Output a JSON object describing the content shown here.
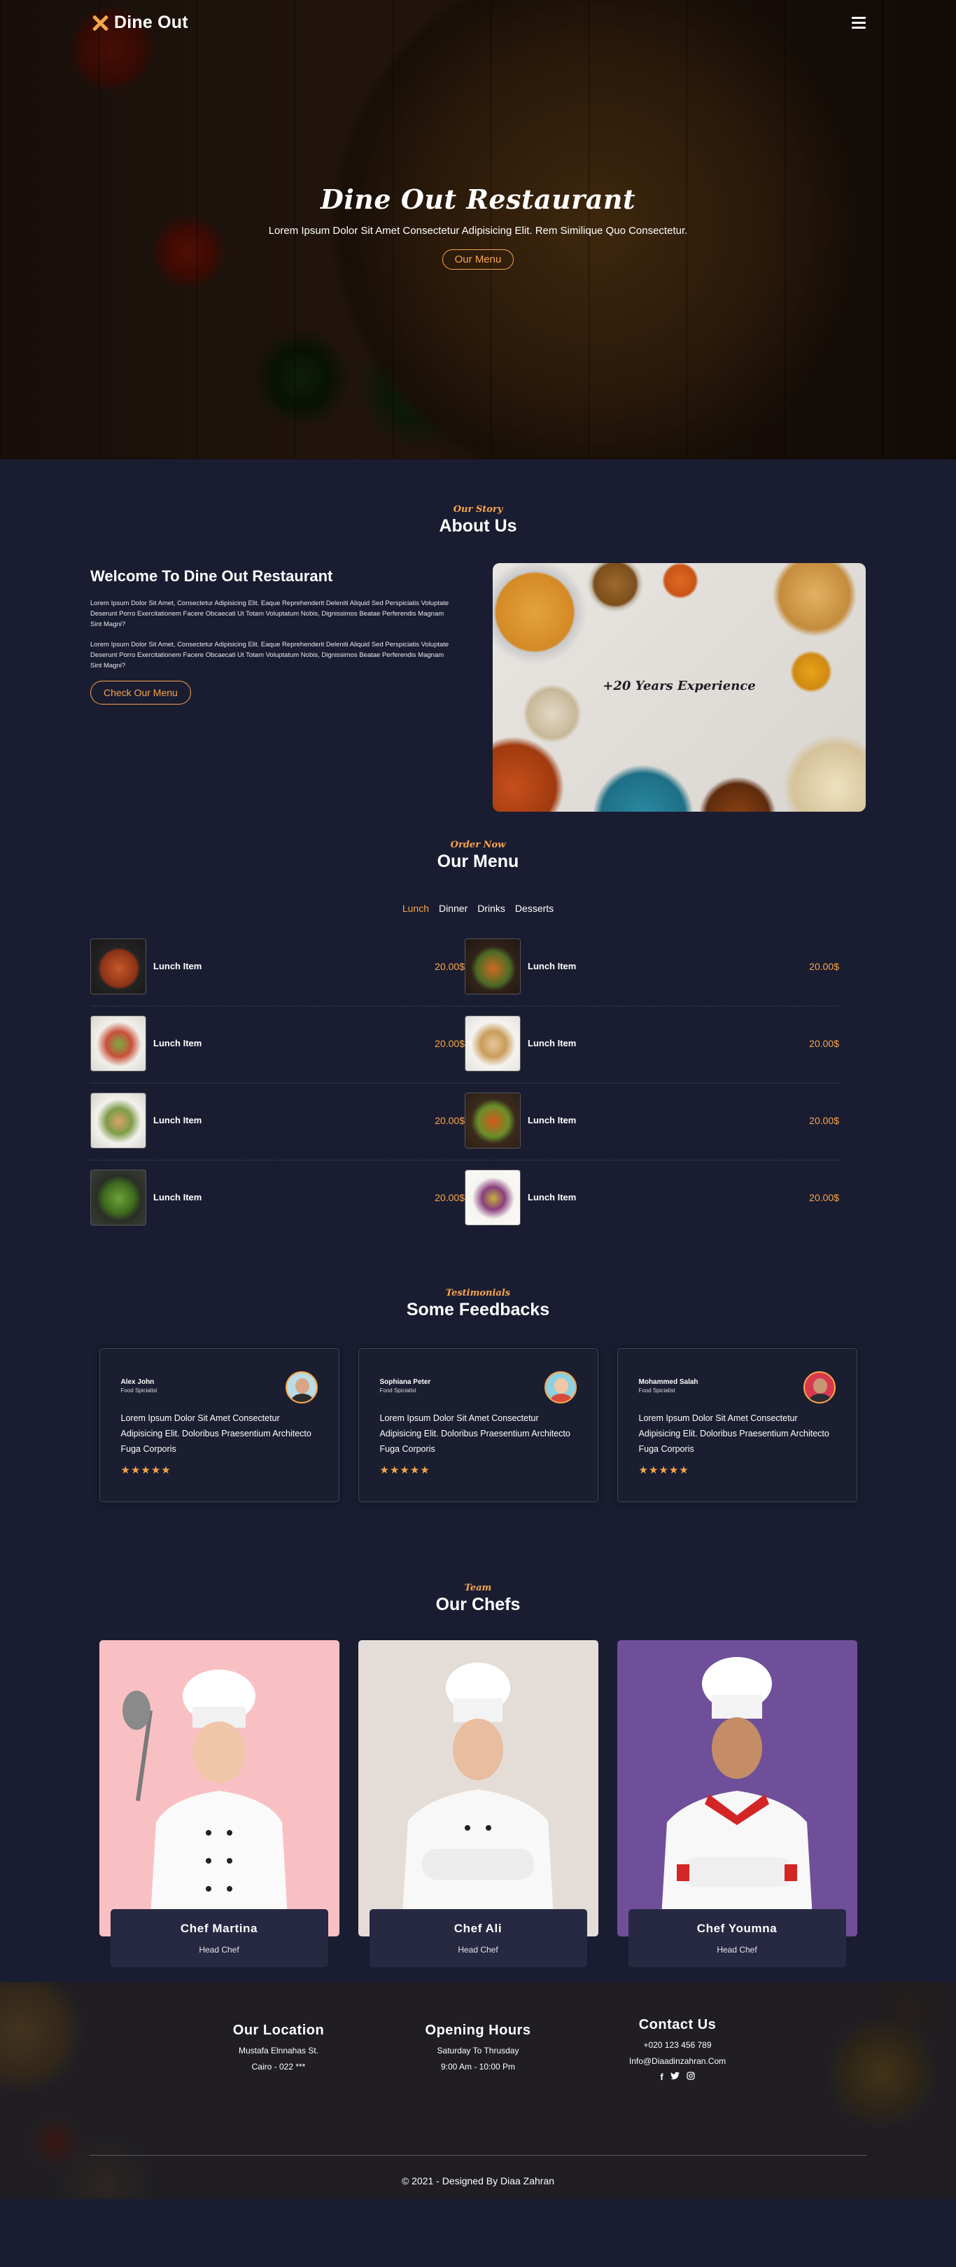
{
  "nav": {
    "brand": "Dine Out"
  },
  "hero": {
    "title": "Dine Out Restaurant",
    "subtitle": "Lorem Ipsum Dolor Sit Amet Consectetur Adipisicing Elit. Rem Similique Quo Consectetur.",
    "button": "Our Menu"
  },
  "about": {
    "kicker": "Our Story",
    "title": "About Us",
    "heading": "Welcome To Dine Out Restaurant",
    "para1": "Lorem Ipsum Dolor Sit Amet, Consectetur Adipisicing Elit. Eaque Reprehenderit Deleniti Aliquid Sed Perspiciatis Voluptate Deserunt Porro Exercitationem Facere Obcaecati Ut Totam Voluptatum Nobis, Dignissimos Beatae Perferendis Magnam Sint Magni?",
    "para2": "Lorem Ipsum Dolor Sit Amet, Consectetur Adipisicing Elit. Eaque Reprehenderit Deleniti Aliquid Sed Perspiciatis Voluptate Deserunt Porro Exercitationem Facere Obcaecati Ut Totam Voluptatum Nobis, Dignissimos Beatae Perferendis Magnam Sint Magni?",
    "button": "Check Our Menu",
    "image_caption": "+20 Years Experience"
  },
  "menu": {
    "kicker": "Order Now",
    "title": "Our Menu",
    "tabs": [
      "Lunch",
      "Dinner",
      "Drinks",
      "Desserts"
    ],
    "active_tab": "Lunch",
    "items": [
      {
        "name": "Lunch Item",
        "price": "20.00$"
      },
      {
        "name": "Lunch Item",
        "price": "20.00$"
      },
      {
        "name": "Lunch Item",
        "price": "20.00$"
      },
      {
        "name": "Lunch Item",
        "price": "20.00$"
      },
      {
        "name": "Lunch Item",
        "price": "20.00$"
      },
      {
        "name": "Lunch Item",
        "price": "20.00$"
      },
      {
        "name": "Lunch Item",
        "price": "20.00$"
      },
      {
        "name": "Lunch Item",
        "price": "20.00$"
      }
    ]
  },
  "testimonials": {
    "kicker": "Testimonials",
    "title": "Some Feedbacks",
    "cards": [
      {
        "name": "Alex John",
        "role": "Food Spicialist",
        "text": "Lorem Ipsum Dolor Sit Amet Consectetur Adipisicing Elit. Doloribus Praesentium Architecto Fuga Corporis",
        "rating": 5,
        "stars": "★★★★★"
      },
      {
        "name": "Sophiana Peter",
        "role": "Food Spicialist",
        "text": "Lorem Ipsum Dolor Sit Amet Consectetur Adipisicing Elit. Doloribus Praesentium Architecto Fuga Corporis",
        "rating": 5,
        "stars": "★★★★★"
      },
      {
        "name": "Mohammed Salah",
        "role": "Food Spicialist",
        "text": "Lorem Ipsum Dolor Sit Amet Consectetur Adipisicing Elit. Doloribus Praesentium Architecto Fuga Corporis",
        "rating": 5,
        "stars": "★★★★★"
      }
    ]
  },
  "team": {
    "kicker": "Team",
    "title": "Our Chefs",
    "chefs": [
      {
        "name": "Chef Martina",
        "role": "Head Chef",
        "bg": "#f9c0c4"
      },
      {
        "name": "Chef Ali",
        "role": "Head Chef",
        "bg": "#e4ddd7"
      },
      {
        "name": "Chef Youmna",
        "role": "Head Chef",
        "bg": "#6f4f9a"
      }
    ]
  },
  "footer": {
    "location": {
      "title": "Our Location",
      "line1": "Mustafa Elnnahas St.",
      "line2": "Cairo - 022 ***"
    },
    "hours": {
      "title": "Opening Hours",
      "line1": "Saturday To Thrusday",
      "line2": "9:00 Am - 10:00 Pm"
    },
    "contact": {
      "title": "Contact Us",
      "phone": "+020 123 456 789",
      "email": "Info@Diaadinzahran.Com"
    },
    "social_icons": [
      "facebook-icon",
      "twitter-icon",
      "instagram-icon"
    ],
    "copyright": "© 2021 - Designed By Diaa Zahran"
  },
  "colors": {
    "accent": "#f7a54b",
    "background": "#1a1d31",
    "card_caption": "#272842"
  }
}
